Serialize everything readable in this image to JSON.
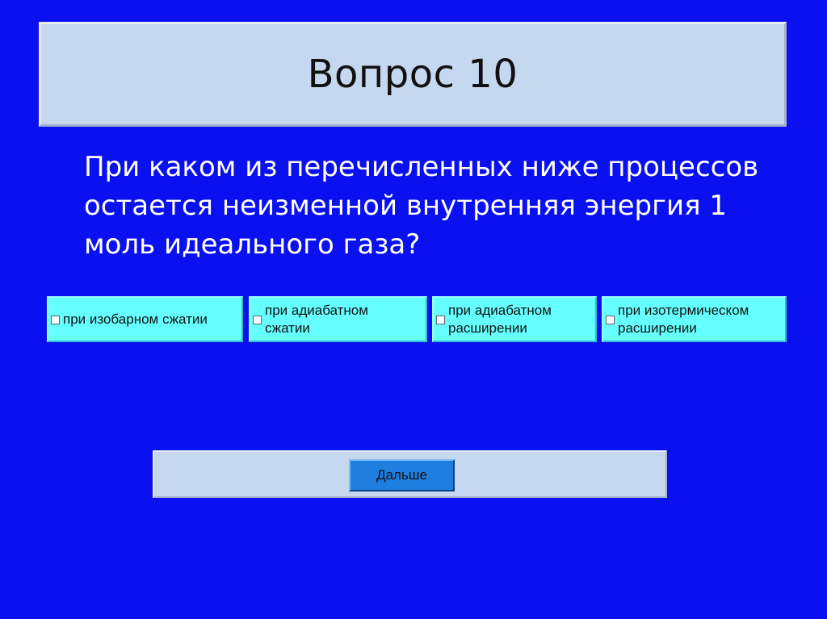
{
  "title": "Вопрос 10",
  "question": "При каком из перечисленных ниже процессов остается неизменной внутренняя энергия 1 моль идеального газа?",
  "options": [
    {
      "label": "при изобарном сжатии"
    },
    {
      "label": "при адиабатном сжатии"
    },
    {
      "label": "при адиабатном расширении"
    },
    {
      "label": "при изотермическом расширении"
    }
  ],
  "next_button": {
    "label": "Дальше"
  },
  "colors": {
    "background": "#0a10f0",
    "panel": "#c5d8f0",
    "option": "#66ffff",
    "button": "#1e7fe0",
    "question_text": "#ffffff"
  }
}
